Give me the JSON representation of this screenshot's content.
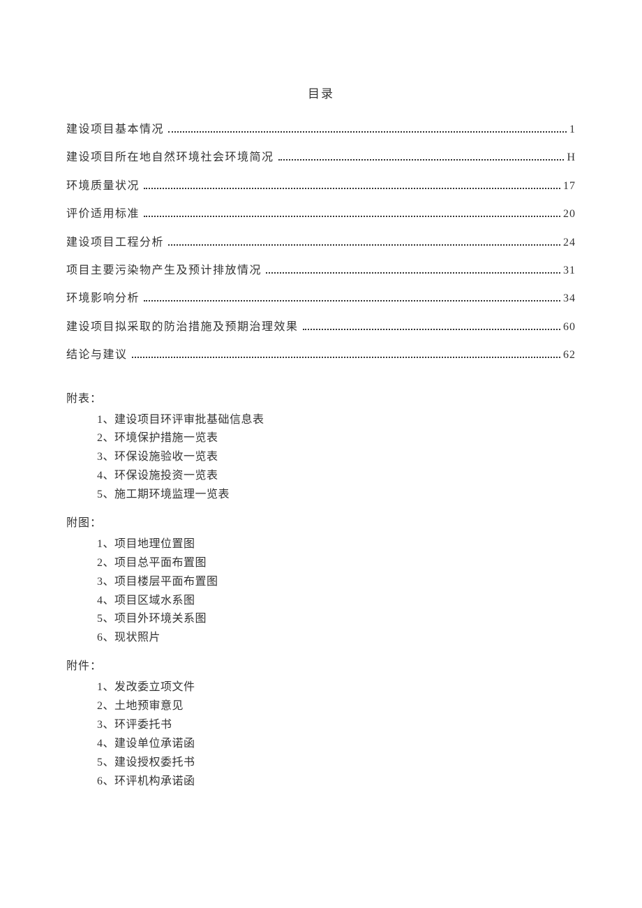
{
  "title": "目录",
  "toc": [
    {
      "label": "建设项目基本情况",
      "page": "1"
    },
    {
      "label": "建设项目所在地自然环境社会环境简况",
      "page": "H"
    },
    {
      "label": "环境质量状况",
      "page": "17"
    },
    {
      "label": "评价适用标准",
      "page": "20"
    },
    {
      "label": "建设项目工程分析",
      "page": "24"
    },
    {
      "label": "项目主要污染物产生及预计排放情况",
      "page": "31"
    },
    {
      "label": "环境影响分析",
      "page": "34"
    },
    {
      "label": "建设项目拟采取的防治措施及预期治理效果",
      "page": "60"
    },
    {
      "label": "结论与建议",
      "page": "62"
    }
  ],
  "sections": [
    {
      "heading": "附表：",
      "items": [
        "1、建设项目环评审批基础信息表",
        "2、环境保护措施一览表",
        "3、环保设施验收一览表",
        "4、环保设施投资一览表",
        "5、施工期环境监理一览表"
      ]
    },
    {
      "heading": "附图：",
      "items": [
        "1、项目地理位置图",
        "2、项目总平面布置图",
        "3、项目楼层平面布置图",
        "4、项目区域水系图",
        "5、项目外环境关系图",
        "6、现状照片"
      ]
    },
    {
      "heading": "附件：",
      "items": [
        "1、发改委立项文件",
        "2、土地预审意见",
        "3、环评委托书",
        "4、建设单位承诺函",
        "5、建设授权委托书",
        "6、环评机构承诺函"
      ]
    }
  ]
}
